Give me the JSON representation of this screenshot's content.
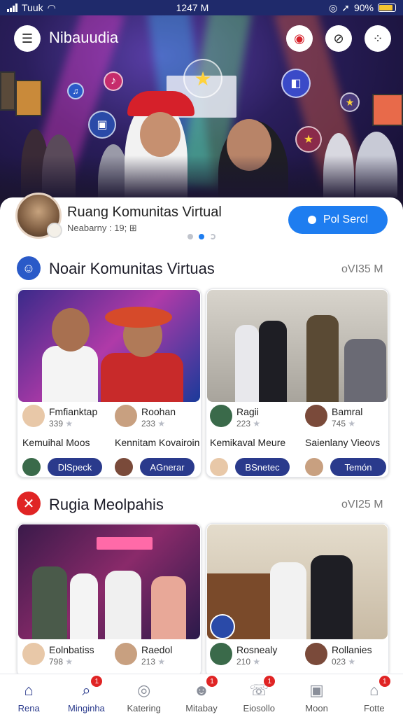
{
  "status_bar": {
    "carrier": "Tuuk",
    "time": "1247 M",
    "battery": "90%",
    "battery_level": 0.9
  },
  "header": {
    "title": "Nibauudia"
  },
  "profile": {
    "name": "Ruang Komunitas Virtual",
    "subtitle": "Neabarny : 19; ",
    "action_label": "Pol Sercl"
  },
  "sections": [
    {
      "title": "Noair Komunitas Virtuas",
      "meta": "oVI35 M",
      "icon": "community-icon",
      "cards": [
        {
          "name": "Fmfianktap",
          "count": "339",
          "label": "Kemuihal Moos",
          "button": "DlSpeck"
        },
        {
          "name": "Roohan",
          "count": "233",
          "label": "Kennitam Kovairoin",
          "button": "AGnerar"
        },
        {
          "name": "Ragii",
          "count": "223",
          "label": "Kemikaval Meure",
          "button": "BSnetec"
        },
        {
          "name": "Bamral",
          "count": "745",
          "label": "Saienlany Vieovs",
          "button": "Temón"
        }
      ]
    },
    {
      "title": "Rugia Meolpahis",
      "meta": "oVI25 M",
      "icon": "close-icon",
      "cards": [
        {
          "name": "Eolnbatiss",
          "count": "798"
        },
        {
          "name": "Raedol",
          "count": "213"
        },
        {
          "name": "Rosnealy",
          "count": "210"
        },
        {
          "name": "Rollanies",
          "count": "023"
        }
      ]
    }
  ],
  "bottom_nav": [
    {
      "label": "Rena",
      "icon": "home-icon",
      "badge": ""
    },
    {
      "label": "Minginha",
      "icon": "search-icon",
      "badge": "1"
    },
    {
      "label": "Katering",
      "icon": "compass-icon",
      "badge": ""
    },
    {
      "label": "Mitabay",
      "icon": "people-icon",
      "badge": "1"
    },
    {
      "label": "Eiosollo",
      "icon": "chat-icon",
      "badge": "1"
    },
    {
      "label": "Moon",
      "icon": "profile-icon",
      "badge": ""
    },
    {
      "label": "Fotte",
      "icon": "house-icon",
      "badge": "1"
    }
  ],
  "colors": {
    "accent": "#1e7df0",
    "nav_active": "#2a3a8c",
    "badge": "#e02424",
    "status_bar": "#1f2a6b"
  }
}
